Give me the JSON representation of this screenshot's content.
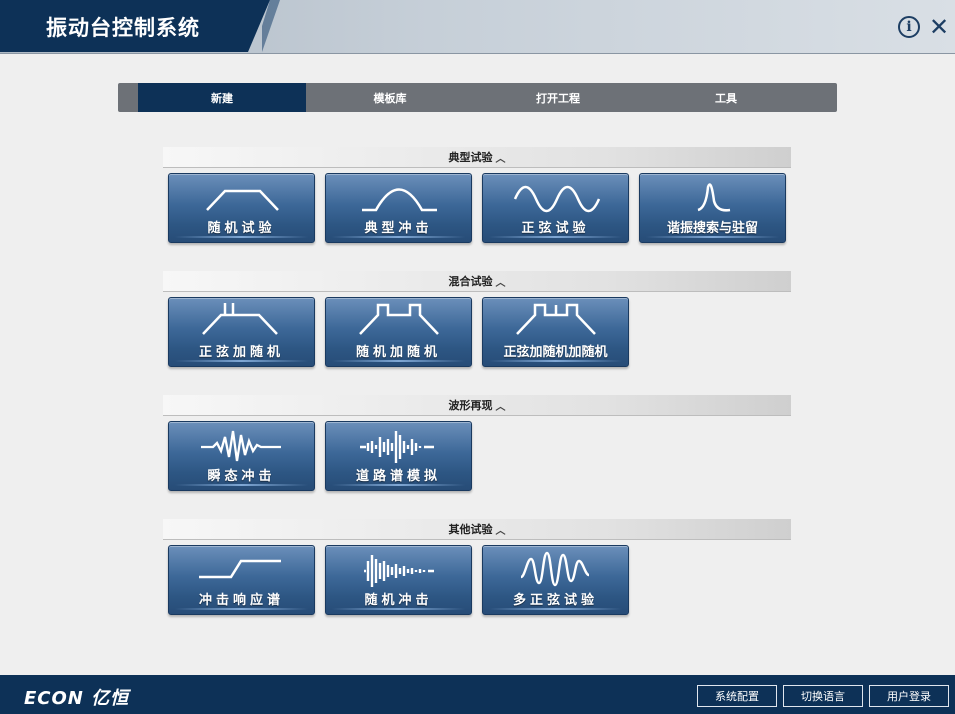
{
  "window": {
    "title": "振动台控制系统"
  },
  "tabs": [
    {
      "label": "新建",
      "active": true
    },
    {
      "label": "模板库",
      "active": false
    },
    {
      "label": "打开工程",
      "active": false
    },
    {
      "label": "工具",
      "active": false
    }
  ],
  "sections": [
    {
      "title": "典型试验",
      "items": [
        {
          "label": "随机试验",
          "icon": "random-trapezoid-icon"
        },
        {
          "label": "典型冲击",
          "icon": "half-sine-icon"
        },
        {
          "label": "正弦试验",
          "icon": "sine-wave-icon"
        },
        {
          "label": "谐振搜索与驻留",
          "icon": "resonance-peak-icon"
        }
      ]
    },
    {
      "title": "混合试验",
      "items": [
        {
          "label": "正弦加随机",
          "icon": "sine-on-random-icon"
        },
        {
          "label": "随机加随机",
          "icon": "random-on-random-icon"
        },
        {
          "label": "正弦加随机加随机",
          "icon": "sine-random-random-icon"
        }
      ]
    },
    {
      "title": "波形再现",
      "items": [
        {
          "label": "瞬态冲击",
          "icon": "transient-wave-icon"
        },
        {
          "label": "道路谱模拟",
          "icon": "road-spectrum-icon"
        }
      ]
    },
    {
      "title": "其他试验",
      "items": [
        {
          "label": "冲击响应谱",
          "icon": "shock-response-icon"
        },
        {
          "label": "随机冲击",
          "icon": "random-shock-icon"
        },
        {
          "label": "多正弦试验",
          "icon": "multi-sine-icon"
        }
      ]
    }
  ],
  "footer": {
    "logo": "ECON 亿恒",
    "buttons": [
      "系统配置",
      "切换语言",
      "用户登录"
    ]
  },
  "colors": {
    "primary": "#0d3157",
    "tile": "#3d6898",
    "tab_bar": "#6d7177"
  }
}
